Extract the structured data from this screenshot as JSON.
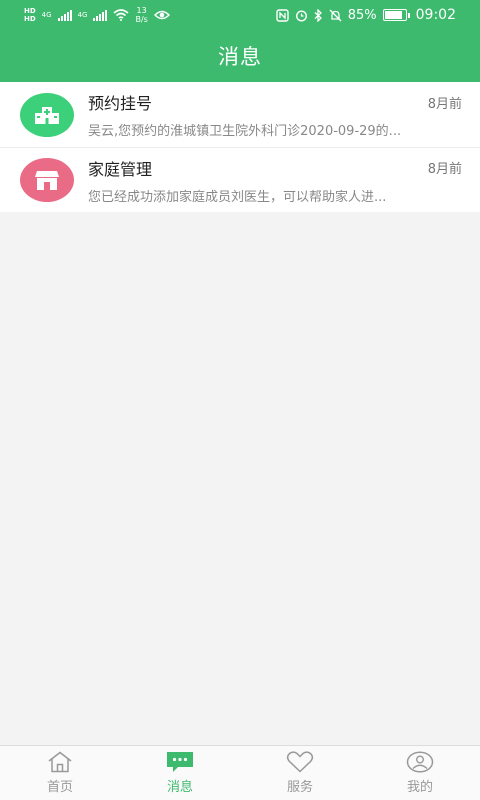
{
  "status_bar": {
    "hd_top": "HD",
    "hd_bottom": "HD",
    "net_a": "4G",
    "net_b": "4G",
    "speed_value": "13",
    "speed_unit": "B/s",
    "battery": "85%",
    "time": "09:02",
    "icons": [
      "nfc-icon",
      "alarm-icon",
      "bluetooth-icon",
      "mute-icon",
      "eye-icon",
      "wifi-icon"
    ]
  },
  "header": {
    "title": "消息"
  },
  "messages": [
    {
      "title": "预约挂号",
      "time": "8月前",
      "preview": "吴云,您预约的淮城镇卫生院外科门诊2020-09-29的...",
      "icon": "hospital-icon",
      "color": "#3dd07a"
    },
    {
      "title": "家庭管理",
      "time": "8月前",
      "preview": "您已经成功添加家庭成员刘医生，可以帮助家人进...",
      "icon": "home-icon",
      "color": "#e96b86"
    }
  ],
  "tabbar": {
    "tabs": [
      {
        "label": "首页",
        "icon": "home-outline-icon",
        "active": false
      },
      {
        "label": "消息",
        "icon": "chat-icon",
        "active": true
      },
      {
        "label": "服务",
        "icon": "heart-icon",
        "active": false
      },
      {
        "label": "我的",
        "icon": "profile-icon",
        "active": false
      }
    ],
    "active_color": "#3dba6e",
    "inactive_color": "#999999"
  },
  "colors": {
    "primary": "#3dba6e",
    "background": "#f3f3f3"
  }
}
